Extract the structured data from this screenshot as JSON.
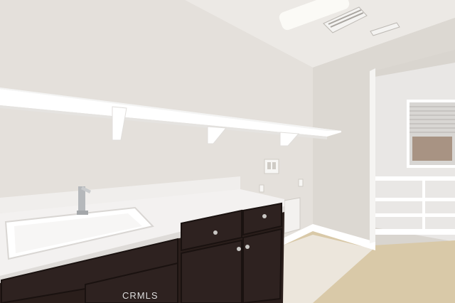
{
  "photo": {
    "watermark": "CRMLS"
  },
  "colors": {
    "wall": "#e6e2dd",
    "wall_shadow": "#d3cec8",
    "ceiling": "#ebe8e4",
    "shelf": "#ffffff",
    "counter": "#f1efee",
    "cabinet": "#2b1f1c",
    "floor": "#d8c7a6",
    "baseboard": "#ffffff"
  },
  "icons": [
    "ceiling-light-icon",
    "air-vent-icon",
    "faucet-icon",
    "window-blinds-icon",
    "cabinet-knob-icon"
  ]
}
